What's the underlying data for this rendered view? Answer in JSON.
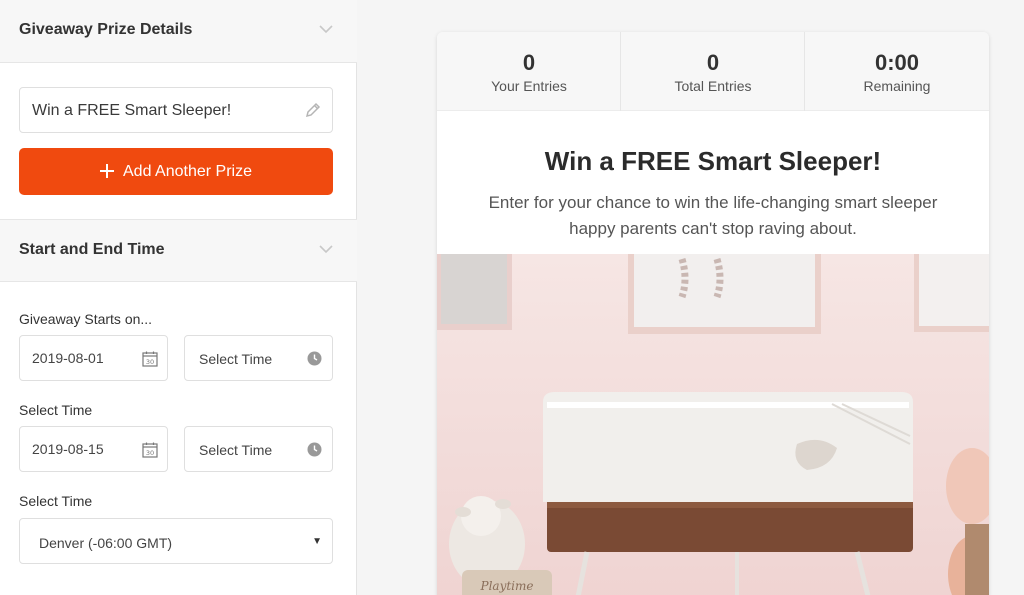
{
  "left_panel": {
    "prize_section": {
      "title": "Giveaway Prize Details",
      "prize_value": "Win a FREE Smart Sleeper!",
      "add_button_label": "Add Another Prize"
    },
    "time_section": {
      "title": "Start and End Time",
      "start_label": "Giveaway Starts on...",
      "start_date": "2019-08-01",
      "start_time_placeholder": "Select Time",
      "end_label": "Select Time",
      "end_date": "2019-08-15",
      "end_time_placeholder": "Select Time",
      "timezone_label": "Select Time",
      "timezone_value": "Denver (-06:00 GMT)"
    }
  },
  "preview": {
    "stats": [
      {
        "value": "0",
        "label": "Your Entries"
      },
      {
        "value": "0",
        "label": "Total Entries"
      },
      {
        "value": "0:00",
        "label": "Remaining"
      }
    ],
    "headline": "Win a FREE Smart Sleeper!",
    "description": "Enter for your chance to win the life-changing smart sleeper happy parents can't stop raving about.",
    "toy_text": "Playtime"
  },
  "colors": {
    "accent": "#f04a0f",
    "panel_bg": "#f7f7f7",
    "hero_bg": "#f3dede"
  },
  "icons": [
    "chevron-down-icon",
    "pencil-icon",
    "plus-icon",
    "calendar-icon",
    "clock-icon",
    "caret-down-icon"
  ]
}
